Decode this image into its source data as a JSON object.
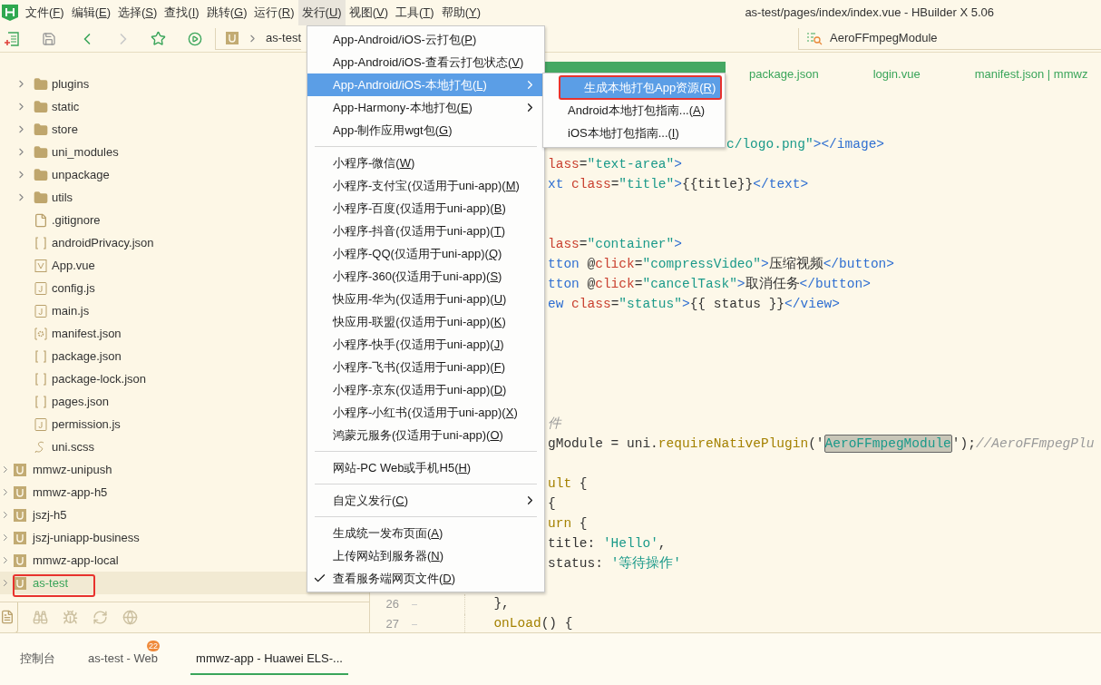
{
  "menu_bar": {
    "items": [
      {
        "label": "文件",
        "mnemonic": "(F)",
        "selected": false
      },
      {
        "label": "编辑",
        "mnemonic": "(E)",
        "selected": false
      },
      {
        "label": "选择",
        "mnemonic": "(S)",
        "selected": false
      },
      {
        "label": "查找",
        "mnemonic": "(I)",
        "selected": false
      },
      {
        "label": "跳转",
        "mnemonic": "(G)",
        "selected": false
      },
      {
        "label": "运行",
        "mnemonic": "(R)",
        "selected": false
      },
      {
        "label": "发行",
        "mnemonic": "(U)",
        "selected": true
      },
      {
        "label": "视图",
        "mnemonic": "(V)",
        "selected": false
      },
      {
        "label": "工具",
        "mnemonic": "(T)",
        "selected": false
      },
      {
        "label": "帮助",
        "mnemonic": "(Y)",
        "selected": false
      }
    ],
    "window_title": "as-test/pages/index/index.vue - HBuilder X 5.06"
  },
  "toolbar": {
    "breadcrumb": [
      "as-test"
    ],
    "search_value": "AeroFFmpegModule"
  },
  "file_tree": [
    {
      "children": [
        {
          "label": "plugins",
          "kind": "folder",
          "expanded": false
        },
        {
          "label": "static",
          "kind": "folder",
          "expanded": false
        },
        {
          "label": "store",
          "kind": "folder",
          "expanded": false
        },
        {
          "label": "uni_modules",
          "kind": "folder",
          "expanded": false
        },
        {
          "label": "unpackage",
          "kind": "folder",
          "expanded": false
        },
        {
          "label": "utils",
          "kind": "folder",
          "expanded": false
        },
        {
          "label": ".gitignore",
          "kind": "file"
        },
        {
          "label": "androidPrivacy.json",
          "kind": "json"
        },
        {
          "label": "App.vue",
          "kind": "vue"
        },
        {
          "label": "config.js",
          "kind": "js"
        },
        {
          "label": "main.js",
          "kind": "js"
        },
        {
          "label": "manifest.json",
          "kind": "manifest"
        },
        {
          "label": "package.json",
          "kind": "json"
        },
        {
          "label": "package-lock.json",
          "kind": "json"
        },
        {
          "label": "pages.json",
          "kind": "json"
        },
        {
          "label": "permission.js",
          "kind": "js"
        },
        {
          "label": "uni.scss",
          "kind": "scss"
        }
      ]
    },
    {
      "label": "mmwz-unipush",
      "kind": "project",
      "expanded": false,
      "selected": false
    },
    {
      "label": "mmwz-app-h5",
      "kind": "project",
      "expanded": false,
      "selected": false
    },
    {
      "label": "jszj-h5",
      "kind": "project",
      "expanded": false,
      "selected": false
    },
    {
      "label": "jszj-uniapp-business",
      "kind": "project",
      "expanded": false,
      "selected": false
    },
    {
      "label": "mmwz-app-local",
      "kind": "project",
      "expanded": false,
      "selected": false
    },
    {
      "label": "as-test",
      "kind": "project",
      "expanded": false,
      "selected": true,
      "annotated": true
    }
  ],
  "editor": {
    "tabs": [
      {
        "selected": true
      },
      {
        "label": "package.json",
        "selected": false
      },
      {
        "label": "login.vue",
        "selected": false
      },
      {
        "label": "manifest.json | mmwz",
        "selected": false
      }
    ],
    "lines": [
      {
        "kind": "tail",
        "tokens": [
          {
            "kind": "string",
            "text": "c/logo.png\""
          },
          {
            "kind": "tag",
            "text": "></image>"
          }
        ]
      },
      {
        "kind": "clipped",
        "tokens": [
          {
            "kind": "attr",
            "text": "lass"
          },
          {
            "kind": "plain",
            "text": "="
          },
          {
            "kind": "string",
            "text": "\"text-area\""
          },
          {
            "kind": "tag",
            "text": ">"
          }
        ]
      },
      {
        "kind": "clipped",
        "tokens": [
          {
            "kind": "tag",
            "text": "xt "
          },
          {
            "kind": "attr",
            "text": "class"
          },
          {
            "kind": "plain",
            "text": "="
          },
          {
            "kind": "string",
            "text": "\"title\""
          },
          {
            "kind": "tag",
            "text": ">"
          },
          {
            "kind": "plain",
            "text": "{{title}}"
          },
          {
            "kind": "tag",
            "text": "</text>"
          }
        ]
      },
      {
        "kind": "blank"
      },
      {
        "kind": "blank"
      },
      {
        "kind": "clipped",
        "tokens": [
          {
            "kind": "attr",
            "text": "lass"
          },
          {
            "kind": "plain",
            "text": "="
          },
          {
            "kind": "string",
            "text": "\"container\""
          },
          {
            "kind": "tag",
            "text": ">"
          }
        ]
      },
      {
        "kind": "clipped",
        "tokens": [
          {
            "kind": "tag",
            "text": "tton "
          },
          {
            "kind": "plain",
            "text": "@"
          },
          {
            "kind": "attr",
            "text": "click"
          },
          {
            "kind": "plain",
            "text": "="
          },
          {
            "kind": "string",
            "text": "\"compressVideo\""
          },
          {
            "kind": "tag",
            "text": ">"
          },
          {
            "kind": "plain",
            "text": "压缩视频"
          },
          {
            "kind": "tag",
            "text": "</button>"
          }
        ]
      },
      {
        "kind": "clipped",
        "tokens": [
          {
            "kind": "tag",
            "text": "tton "
          },
          {
            "kind": "plain",
            "text": "@"
          },
          {
            "kind": "attr",
            "text": "click"
          },
          {
            "kind": "plain",
            "text": "="
          },
          {
            "kind": "string",
            "text": "\"cancelTask\""
          },
          {
            "kind": "tag",
            "text": ">"
          },
          {
            "kind": "plain",
            "text": "取消任务"
          },
          {
            "kind": "tag",
            "text": "</button>"
          }
        ]
      },
      {
        "kind": "clipped",
        "tokens": [
          {
            "kind": "tag",
            "text": "ew "
          },
          {
            "kind": "attr",
            "text": "class"
          },
          {
            "kind": "plain",
            "text": "="
          },
          {
            "kind": "string",
            "text": "\"status\""
          },
          {
            "kind": "tag",
            "text": ">"
          },
          {
            "kind": "plain",
            "text": "{{ status }}"
          },
          {
            "kind": "tag",
            "text": "</view>"
          }
        ]
      },
      {
        "kind": "blank"
      },
      {
        "kind": "blank"
      },
      {
        "kind": "blank"
      },
      {
        "kind": "blank"
      },
      {
        "kind": "blank"
      },
      {
        "kind": "clipped",
        "tokens": [
          {
            "kind": "comment",
            "text": "件"
          }
        ]
      },
      {
        "kind": "clipped",
        "tokens": [
          {
            "kind": "plain",
            "text": "gModule = uni."
          },
          {
            "kind": "func",
            "text": "requireNativePlugin"
          },
          {
            "kind": "plain",
            "text": "('"
          },
          {
            "kind": "match",
            "text": "AeroFFmpegModule"
          },
          {
            "kind": "plain",
            "text": "');"
          },
          {
            "kind": "comment",
            "text": "//AeroFFmpegPlu"
          }
        ]
      },
      {
        "kind": "blank"
      },
      {
        "kind": "clipped",
        "tokens": [
          {
            "kind": "func",
            "text": "ult"
          },
          {
            "kind": "plain",
            "text": " {"
          }
        ]
      },
      {
        "kind": "clipped",
        "tokens": [
          {
            "kind": "plain",
            "text": "{"
          }
        ]
      },
      {
        "kind": "clipped",
        "tokens": [
          {
            "kind": "func",
            "text": "urn"
          },
          {
            "kind": "plain",
            "text": " {"
          }
        ]
      },
      {
        "kind": "clipped",
        "tokens": [
          {
            "kind": "plain",
            "text": "title: "
          },
          {
            "kind": "string",
            "text": "'Hello'"
          },
          {
            "kind": "plain",
            "text": ","
          }
        ]
      },
      {
        "kind": "clipped",
        "tokens": [
          {
            "kind": "plain",
            "text": "status: "
          },
          {
            "kind": "string",
            "text": "'等待操作'"
          }
        ]
      },
      {
        "kind": "blank"
      },
      {
        "kind": "numbered",
        "number": "26",
        "tokens": [
          {
            "kind": "plain",
            "text": "  },"
          }
        ]
      },
      {
        "kind": "numbered",
        "number": "27",
        "tokens": [
          {
            "kind": "func",
            "text": "  onLoad"
          },
          {
            "kind": "plain",
            "text": "() {"
          }
        ]
      }
    ]
  },
  "bottom_panel": {
    "tabs": [
      {
        "label": "控制台",
        "selected": false
      },
      {
        "label": "as-test - Web",
        "badge": "22",
        "selected": false
      },
      {
        "label": "mmwz-app - Huawei ELS-...",
        "selected": true
      }
    ]
  },
  "publish_menu": {
    "items": [
      {
        "kind": "item",
        "label": "App-Android/iOS-云打包",
        "mnemonic": "(P)",
        "selected": false
      },
      {
        "kind": "item",
        "label": "App-Android/iOS-查看云打包状态",
        "mnemonic": "(V)",
        "selected": false
      },
      {
        "kind": "item",
        "label": "App-Android/iOS-本地打包",
        "mnemonic": "(L)",
        "selected": true,
        "submenu": true
      },
      {
        "kind": "item",
        "label": "App-Harmony-本地打包",
        "mnemonic": "(E)",
        "selected": false,
        "submenu": true
      },
      {
        "kind": "item",
        "label": "App-制作应用wgt包",
        "mnemonic": "(G)",
        "selected": false
      },
      {
        "kind": "separator"
      },
      {
        "kind": "item",
        "label": "小程序-微信",
        "mnemonic": "(W)",
        "selected": false
      },
      {
        "kind": "item",
        "label": "小程序-支付宝(仅适用于uni-app)",
        "mnemonic": "(M)",
        "selected": false
      },
      {
        "kind": "item",
        "label": "小程序-百度(仅适用于uni-app)",
        "mnemonic": "(B)",
        "selected": false
      },
      {
        "kind": "item",
        "label": "小程序-抖音(仅适用于uni-app)",
        "mnemonic": "(T)",
        "selected": false
      },
      {
        "kind": "item",
        "label": "小程序-QQ(仅适用于uni-app)",
        "mnemonic": "(Q)",
        "selected": false
      },
      {
        "kind": "item",
        "label": "小程序-360(仅适用于uni-app)",
        "mnemonic": "(S)",
        "selected": false
      },
      {
        "kind": "item",
        "label": "快应用-华为(仅适用于uni-app)",
        "mnemonic": "(U)",
        "selected": false
      },
      {
        "kind": "item",
        "label": "快应用-联盟(仅适用于uni-app)",
        "mnemonic": "(K)",
        "selected": false
      },
      {
        "kind": "item",
        "label": "小程序-快手(仅适用于uni-app)",
        "mnemonic": "(J)",
        "selected": false
      },
      {
        "kind": "item",
        "label": "小程序-飞书(仅适用于uni-app)",
        "mnemonic": "(F)",
        "selected": false
      },
      {
        "kind": "item",
        "label": "小程序-京东(仅适用于uni-app)",
        "mnemonic": "(D)",
        "selected": false
      },
      {
        "kind": "item",
        "label": "小程序-小红书(仅适用于uni-app)",
        "mnemonic": "(X)",
        "selected": false
      },
      {
        "kind": "item",
        "label": "鸿蒙元服务(仅适用于uni-app)",
        "mnemonic": "(O)",
        "selected": false
      },
      {
        "kind": "separator"
      },
      {
        "kind": "item",
        "label": "网站-PC Web或手机H5",
        "mnemonic": "(H)",
        "selected": false
      },
      {
        "kind": "separator"
      },
      {
        "kind": "item",
        "label": "自定义发行",
        "mnemonic": "(C)",
        "selected": false,
        "submenu": true
      },
      {
        "kind": "separator"
      },
      {
        "kind": "item",
        "label": "生成统一发布页面",
        "mnemonic": "(A)",
        "selected": false
      },
      {
        "kind": "item",
        "label": "上传网站到服务器",
        "mnemonic": "(N)",
        "selected": false
      },
      {
        "kind": "item",
        "label": "查看服务端网页文件",
        "mnemonic": "(D)",
        "selected": false,
        "checked": true
      }
    ]
  },
  "local_pack_submenu": {
    "items": [
      {
        "label": "生成本地打包App资源",
        "mnemonic": "(R)",
        "selected": true,
        "annotated": true
      },
      {
        "label": "Android本地打包指南...",
        "mnemonic": "(A)",
        "selected": false
      },
      {
        "label": "iOS本地打包指南...",
        "mnemonic": "(I)",
        "selected": false
      }
    ]
  }
}
